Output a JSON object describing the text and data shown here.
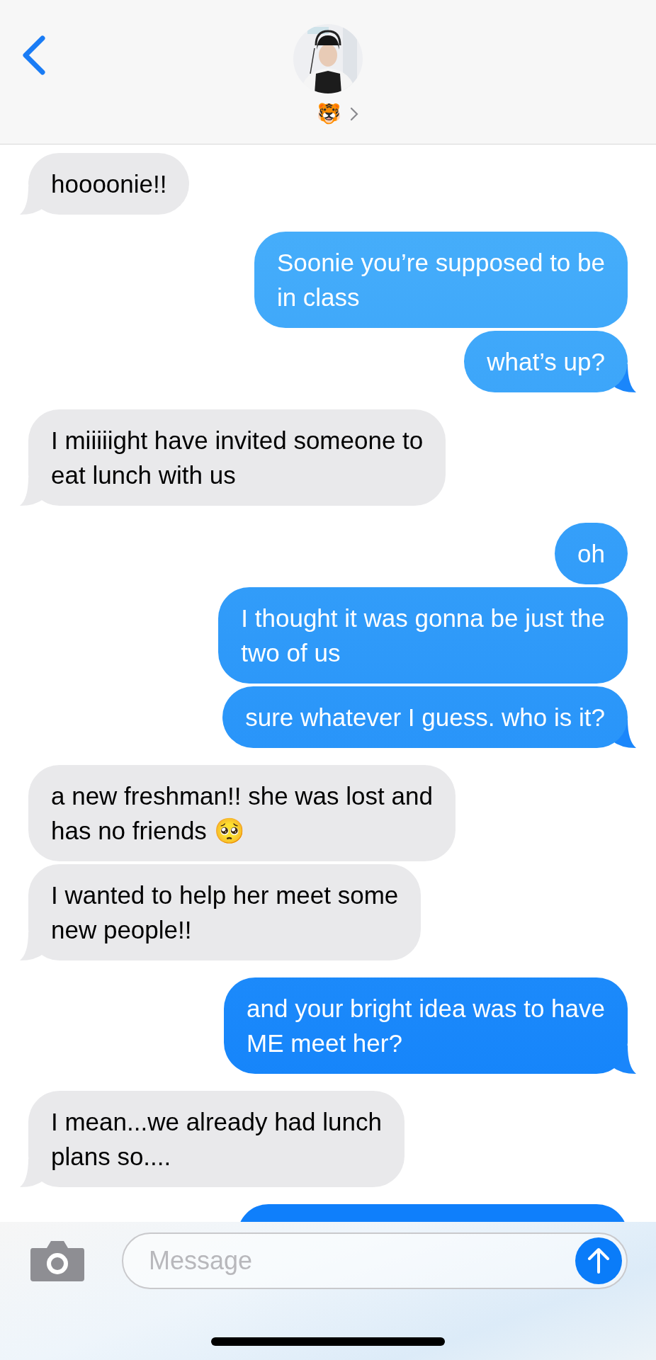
{
  "header": {
    "contact_name": "🐯"
  },
  "messages": [
    {
      "kind": "received",
      "text": "hoooonie!!",
      "tail": true
    },
    {
      "kind": "sent",
      "text": "Soonie you’re supposed to be\nin class",
      "tail": false
    },
    {
      "kind": "sent",
      "text": "what’s up?",
      "tail": true
    },
    {
      "kind": "received",
      "text": "I miiiiight have invited someone to\neat lunch with us",
      "tail": true
    },
    {
      "kind": "sent",
      "text": "oh",
      "tail": false
    },
    {
      "kind": "sent",
      "text": "I thought it was gonna be just the\ntwo of us",
      "tail": false
    },
    {
      "kind": "sent",
      "text": "sure whatever I guess. who is it?",
      "tail": true
    },
    {
      "kind": "received",
      "text": "a new freshman!! she was lost and\nhas no friends 🥺",
      "tail": false
    },
    {
      "kind": "received",
      "text": "I wanted to help her meet some\nnew people!!",
      "tail": true
    },
    {
      "kind": "sent",
      "text": "and your bright idea was to have\nME meet her?",
      "tail": true
    },
    {
      "kind": "received",
      "text": "I mean...we already had lunch\nplans so....",
      "tail": true
    },
    {
      "kind": "sent"
    }
  ],
  "composer": {
    "placeholder": "Message"
  }
}
